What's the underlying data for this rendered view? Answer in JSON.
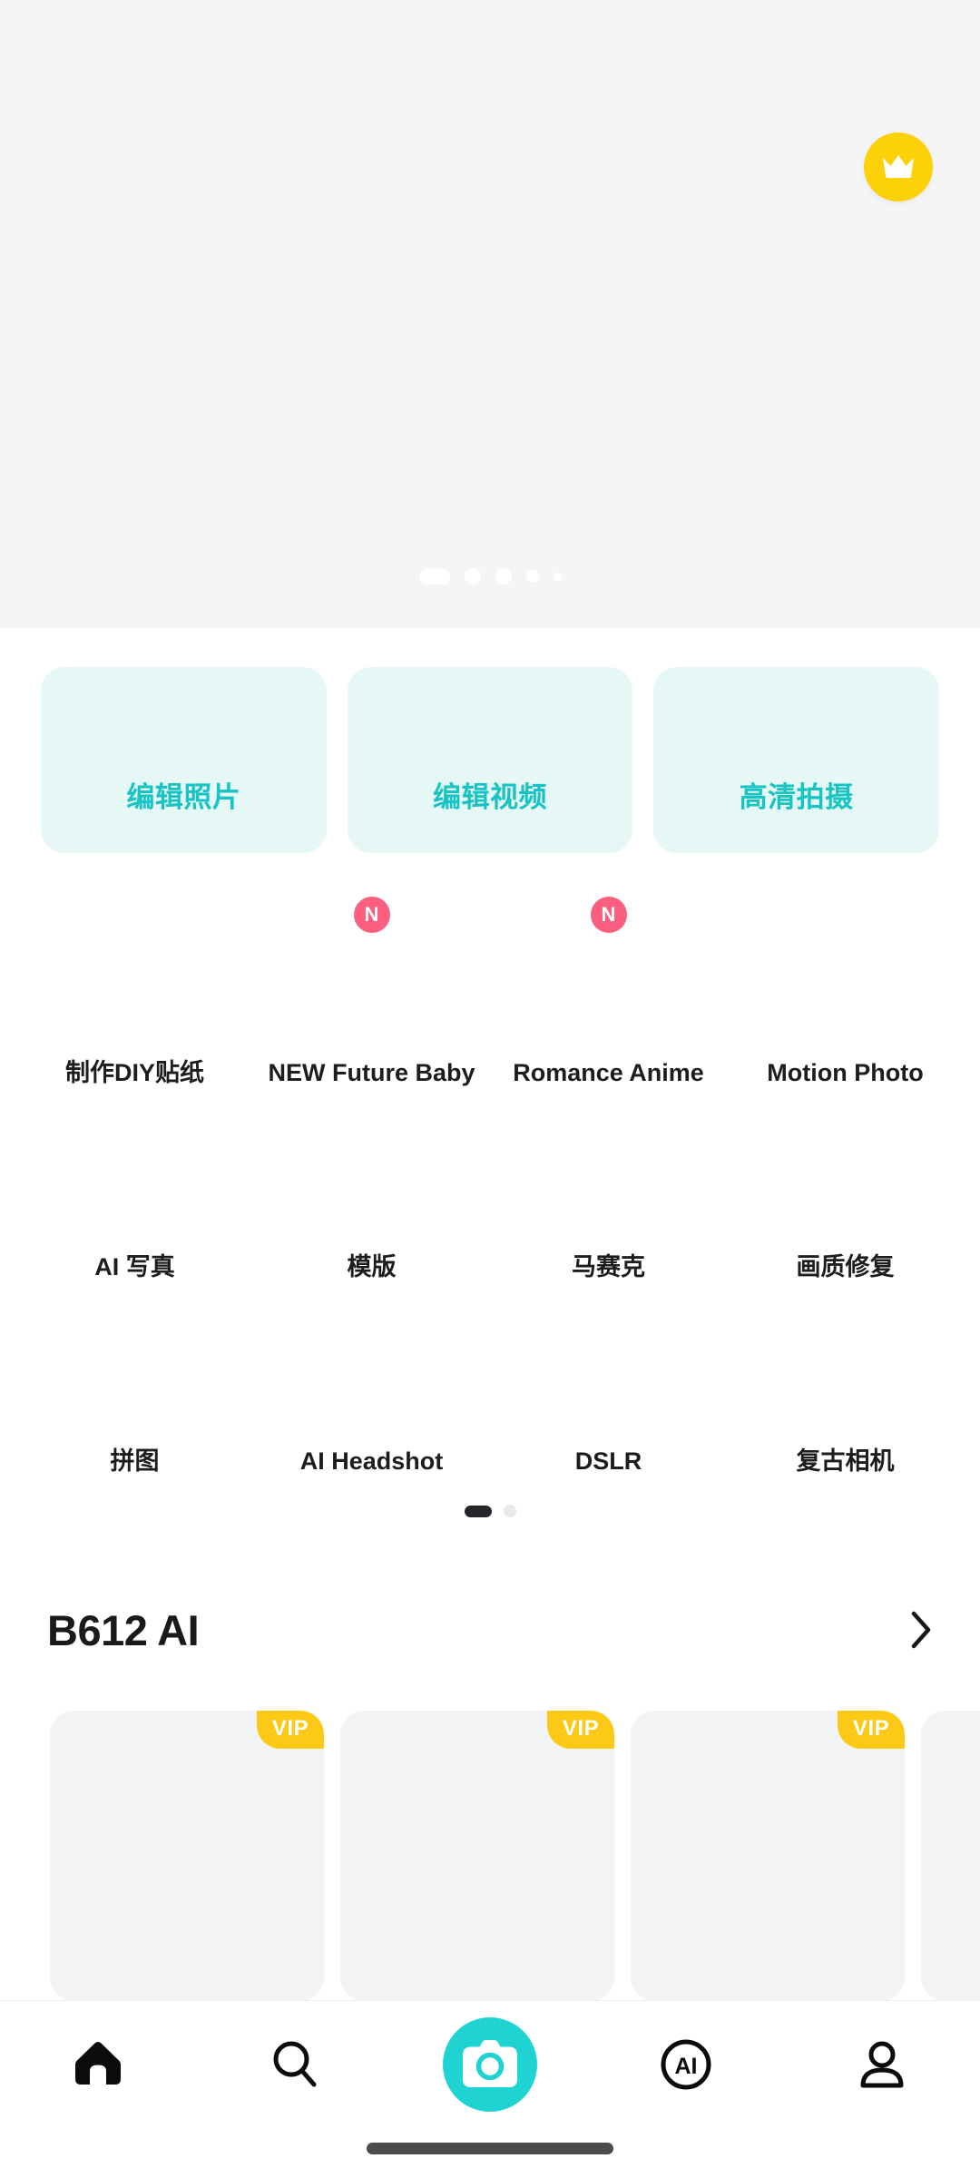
{
  "app": {
    "background_color": "#ffffff",
    "accent_color": "#1fd3d3",
    "mint_card_bg": "#e6f8f6",
    "mint_card_text": "#17c3c3",
    "badge_pink": "#fb5f7f",
    "vip_yellow": "#fcc916",
    "crown_yellow": "#fcd10a"
  },
  "banner": {
    "background_color": "#f4f5f7",
    "vip_button": {
      "icon": "crown-icon",
      "color": "#fcd10a"
    },
    "dots": {
      "count": 5,
      "active_index": 0
    }
  },
  "quick_actions": [
    {
      "label": "编辑照片"
    },
    {
      "label": "编辑视频"
    },
    {
      "label": "高清拍摄"
    }
  ],
  "feature_grid": {
    "rows": [
      [
        {
          "label": "制作DIY贴纸",
          "badge": ""
        },
        {
          "label": "NEW Future Baby",
          "badge": "N"
        },
        {
          "label": "Romance Anime",
          "badge": "N"
        },
        {
          "label": "Motion Photo",
          "badge": ""
        }
      ],
      [
        {
          "label": "AI 写真",
          "badge": ""
        },
        {
          "label": "模版",
          "badge": ""
        },
        {
          "label": "马赛克",
          "badge": ""
        },
        {
          "label": "画质修复",
          "badge": ""
        }
      ],
      [
        {
          "label": "拼图",
          "badge": ""
        },
        {
          "label": "AI Headshot",
          "badge": ""
        },
        {
          "label": "DSLR",
          "badge": ""
        },
        {
          "label": "复古相机",
          "badge": ""
        }
      ]
    ],
    "pager": {
      "count": 2,
      "active_index": 0
    }
  },
  "b612_ai_section": {
    "title": "B612 AI",
    "more_icon": "chevron-right-icon",
    "cards": [
      {
        "badge": "VIP"
      },
      {
        "badge": "VIP"
      },
      {
        "badge": "VIP"
      },
      {
        "badge": ""
      }
    ]
  },
  "bottom_nav": {
    "items": [
      {
        "name": "home",
        "icon": "home-icon",
        "active": true
      },
      {
        "name": "discover",
        "icon": "search-icon",
        "active": false
      },
      {
        "name": "camera",
        "icon": "camera-icon",
        "active": false
      },
      {
        "name": "ai",
        "icon": "ai-circle-icon",
        "active": false
      },
      {
        "name": "profile",
        "icon": "person-icon",
        "active": false
      }
    ]
  }
}
